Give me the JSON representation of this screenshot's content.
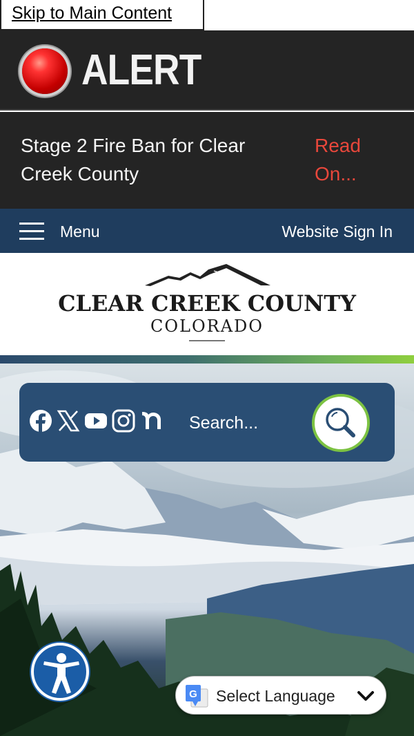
{
  "skip_link": "Skip to Main Content",
  "alert": {
    "title": "ALERT",
    "message": "Stage 2 Fire Ban for Clear Creek County",
    "read_more": "Read On..."
  },
  "nav": {
    "menu_label": "Menu",
    "signin_label": "Website Sign In"
  },
  "logo": {
    "line1": "CLEAR CREEK COUNTY",
    "line2": "COLORADO"
  },
  "search": {
    "placeholder": "Search...",
    "social_icons": [
      "facebook-icon",
      "x-icon",
      "youtube-icon",
      "instagram-icon",
      "nextdoor-icon"
    ]
  },
  "language": {
    "label": "Select Language"
  },
  "colors": {
    "alert_bg": "#242424",
    "alert_link": "#e8473b",
    "nav_bg": "#1f3d5e",
    "search_panel": "#2a4e74",
    "search_ring": "#7cc242",
    "a11y_bg": "#1b5da7"
  }
}
